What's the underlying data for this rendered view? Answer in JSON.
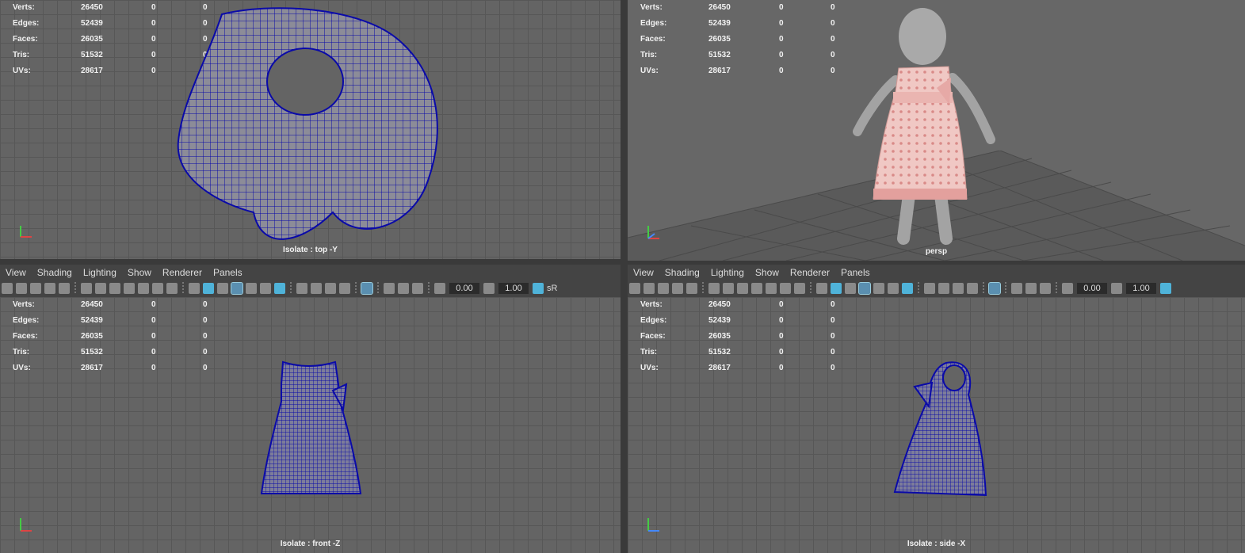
{
  "hud_labels": {
    "verts": "Verts:",
    "edges": "Edges:",
    "faces": "Faces:",
    "tris": "Tris:",
    "uvs": "UVs:"
  },
  "hud_values": {
    "verts": "26450",
    "edges": "52439",
    "faces": "26035",
    "tris": "51532",
    "uvs": "28617",
    "zero": "0"
  },
  "viewports": {
    "top": {
      "label": "Isolate : top -Y"
    },
    "persp": {
      "label": "persp"
    },
    "front": {
      "label": "Isolate : front -Z"
    },
    "side": {
      "label": "Isolate : side -X"
    }
  },
  "menu": {
    "view": "View",
    "shading": "Shading",
    "lighting": "Lighting",
    "show": "Show",
    "renderer": "Renderer",
    "panels": "Panels"
  },
  "toolbar": {
    "exposure": "0.00",
    "gamma": "1.00",
    "sr": "sR"
  },
  "colors": {
    "wire": "#0a0aa8",
    "dress_pink": "#e9a7a3",
    "grid": "#575757",
    "viewport_bg": "#646464"
  }
}
